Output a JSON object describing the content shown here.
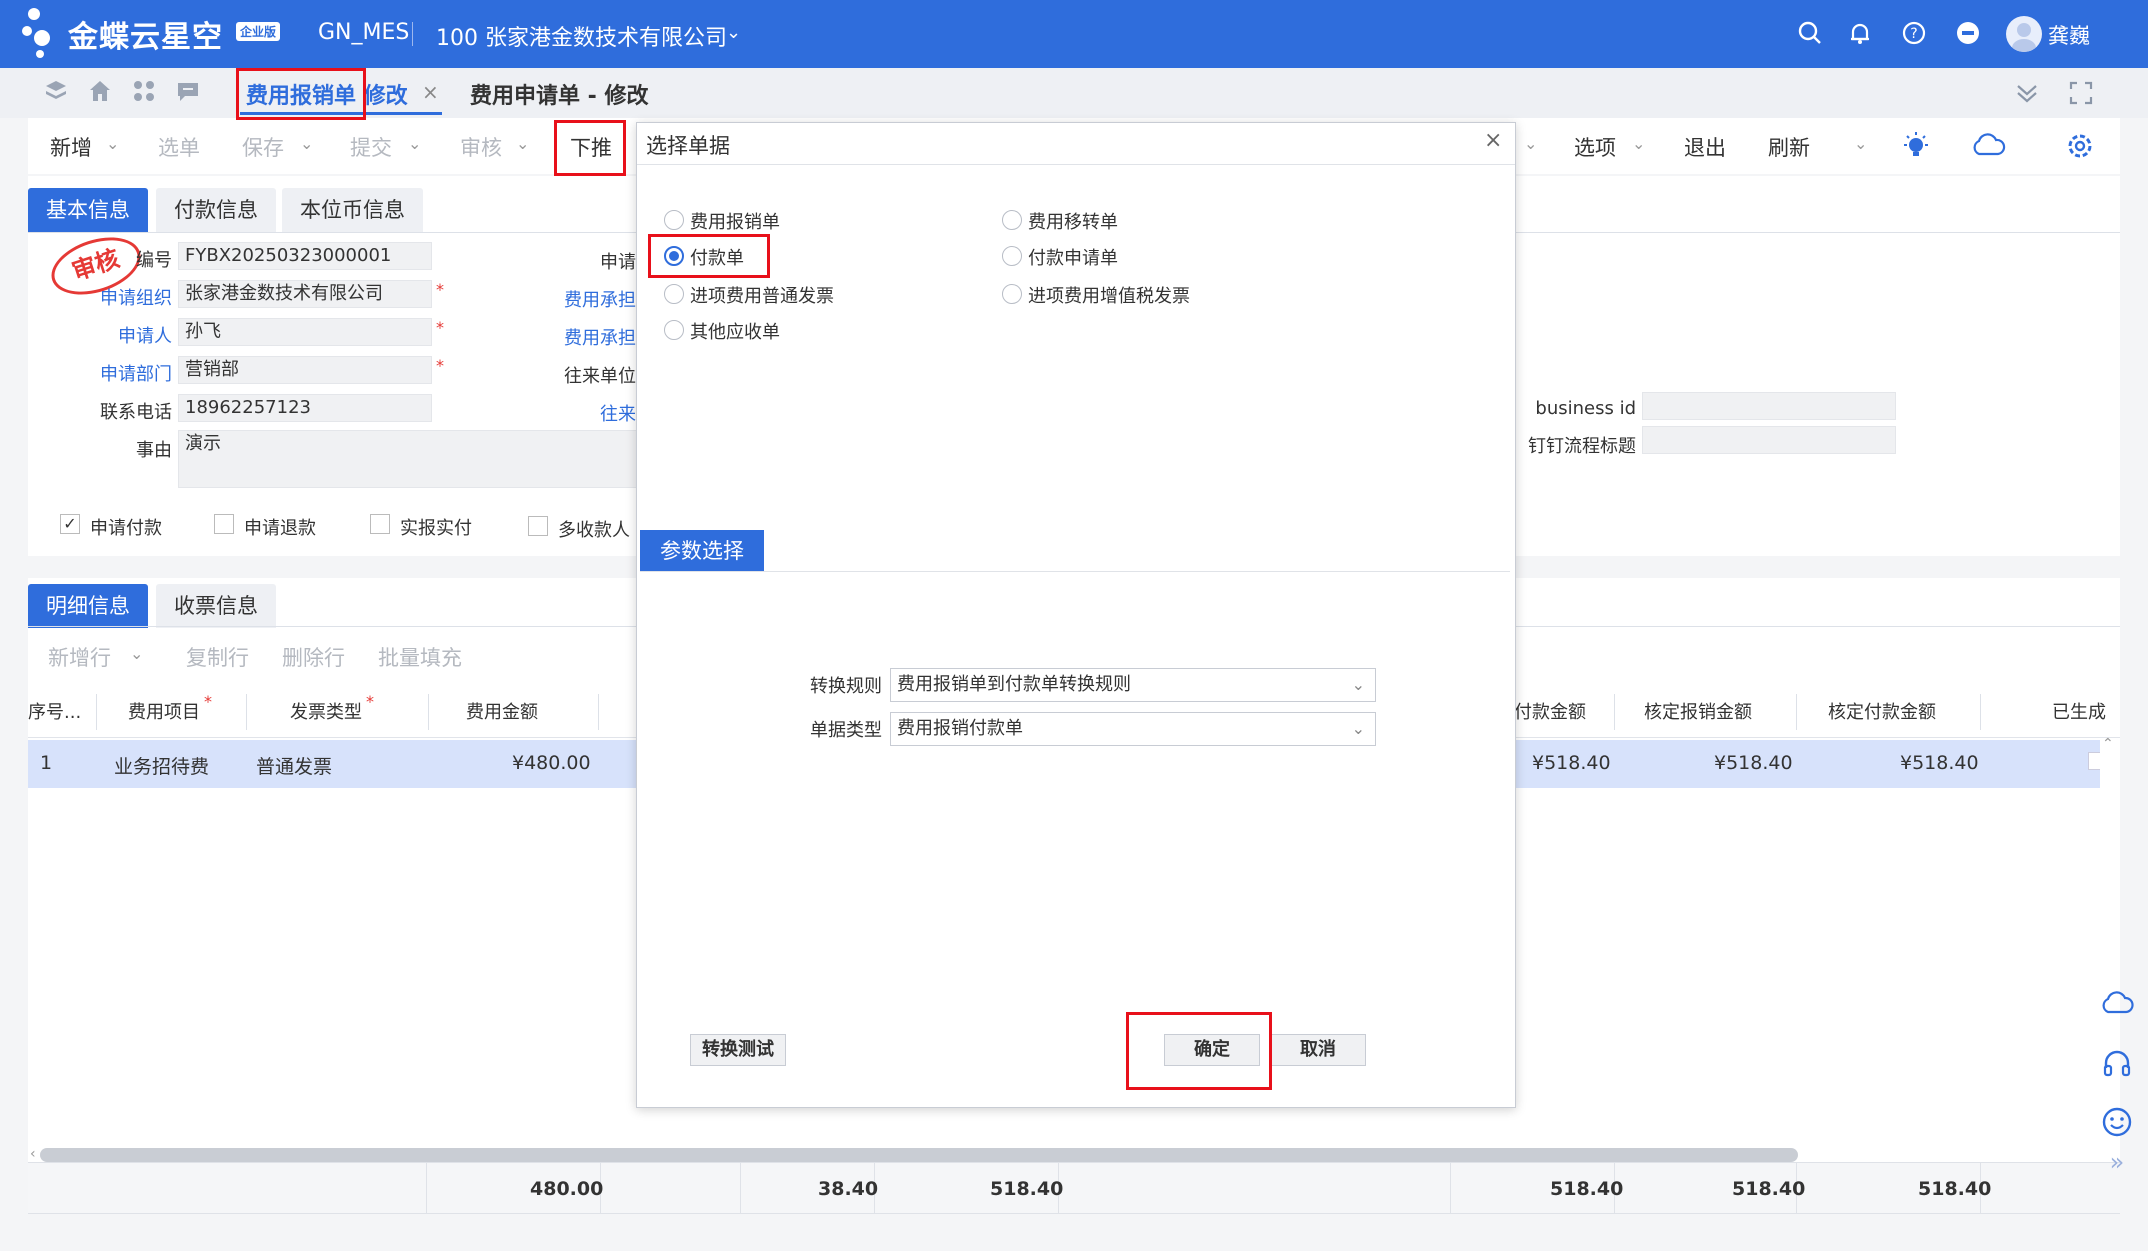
{
  "topbar": {
    "logo_text": "金蝶云星空",
    "logo_badge": "企业版",
    "app_name": "GN_MES",
    "org_name": "100 张家港金数技术有限公司",
    "user_name": "龚巍"
  },
  "tabs": {
    "tab1_label": "费用报销单 修改",
    "tab1_close": "×",
    "tab2_label": "费用申请单 - 修改"
  },
  "toolbar": {
    "new": "新增",
    "select_doc": "选单",
    "save": "保存",
    "submit": "提交",
    "audit": "审核",
    "push_down": "下推",
    "options": "选项",
    "exit": "退出",
    "refresh": "刷新"
  },
  "header_tabs": [
    "基本信息",
    "付款信息",
    "本位币信息"
  ],
  "stamp": "审核",
  "form": {
    "bill_no_label": "编号",
    "bill_no": "FYBX20250323000001",
    "org_label": "申请组织",
    "org": "张家港金数技术有限公司",
    "applicant_label": "申请人",
    "applicant": "孙飞",
    "dept_label": "申请部门",
    "dept": "营销部",
    "phone_label": "联系电话",
    "phone": "18962257123",
    "reason_label": "事由",
    "reason": "演示",
    "col2_label1": "申请",
    "col2_label2": "费用承担",
    "col2_label3": "费用承担",
    "col2_label4": "往来单位",
    "col2_label5": "往来",
    "business_id_label": "business id",
    "dingding_label": "钉钉流程标题"
  },
  "checkboxes": [
    {
      "label": "申请付款",
      "checked": true
    },
    {
      "label": "申请退款",
      "checked": false
    },
    {
      "label": "实报实付",
      "checked": false
    },
    {
      "label": "多收款人",
      "checked": false
    }
  ],
  "detail_tabs": [
    "明细信息",
    "收票信息"
  ],
  "detail_toolbar": [
    "新增行",
    "复制行",
    "删除行",
    "批量填充"
  ],
  "grid": {
    "headers_left": [
      "序号...",
      "费用项目",
      "发票类型",
      "费用金额"
    ],
    "headers_right": [
      "付款金额",
      "核定报销金额",
      "核定付款金额",
      "已生成"
    ],
    "row": {
      "seq": "1",
      "expense_item": "业务招待费",
      "invoice_type": "普通发票",
      "amount": "¥480.00",
      "pay_amount": "¥518.40",
      "approved_reimb": "¥518.40",
      "approved_pay": "¥518.40"
    },
    "totals": [
      "480.00",
      "38.40",
      "518.40",
      "518.40",
      "518.40",
      "518.40"
    ]
  },
  "dialog": {
    "title": "选择单据",
    "close": "×",
    "options": [
      {
        "label": "费用报销单",
        "selected": false
      },
      {
        "label": "费用移转单",
        "selected": false
      },
      {
        "label": "付款单",
        "selected": true
      },
      {
        "label": "付款申请单",
        "selected": false
      },
      {
        "label": "进项费用普通发票",
        "selected": false
      },
      {
        "label": "进项费用增值税发票",
        "selected": false
      },
      {
        "label": "其他应收单",
        "selected": false
      }
    ],
    "param_tab": "参数选择",
    "rule_label": "转换规则",
    "rule_value": "费用报销单到付款单转换规则",
    "billtype_label": "单据类型",
    "billtype_value": "费用报销付款单",
    "test_button": "转换测试",
    "ok_button": "确定",
    "cancel_button": "取消"
  },
  "colors": {
    "brand": "#2f6ddc",
    "highlight": "#e8101a",
    "selected_row": "#d7e2fb"
  }
}
